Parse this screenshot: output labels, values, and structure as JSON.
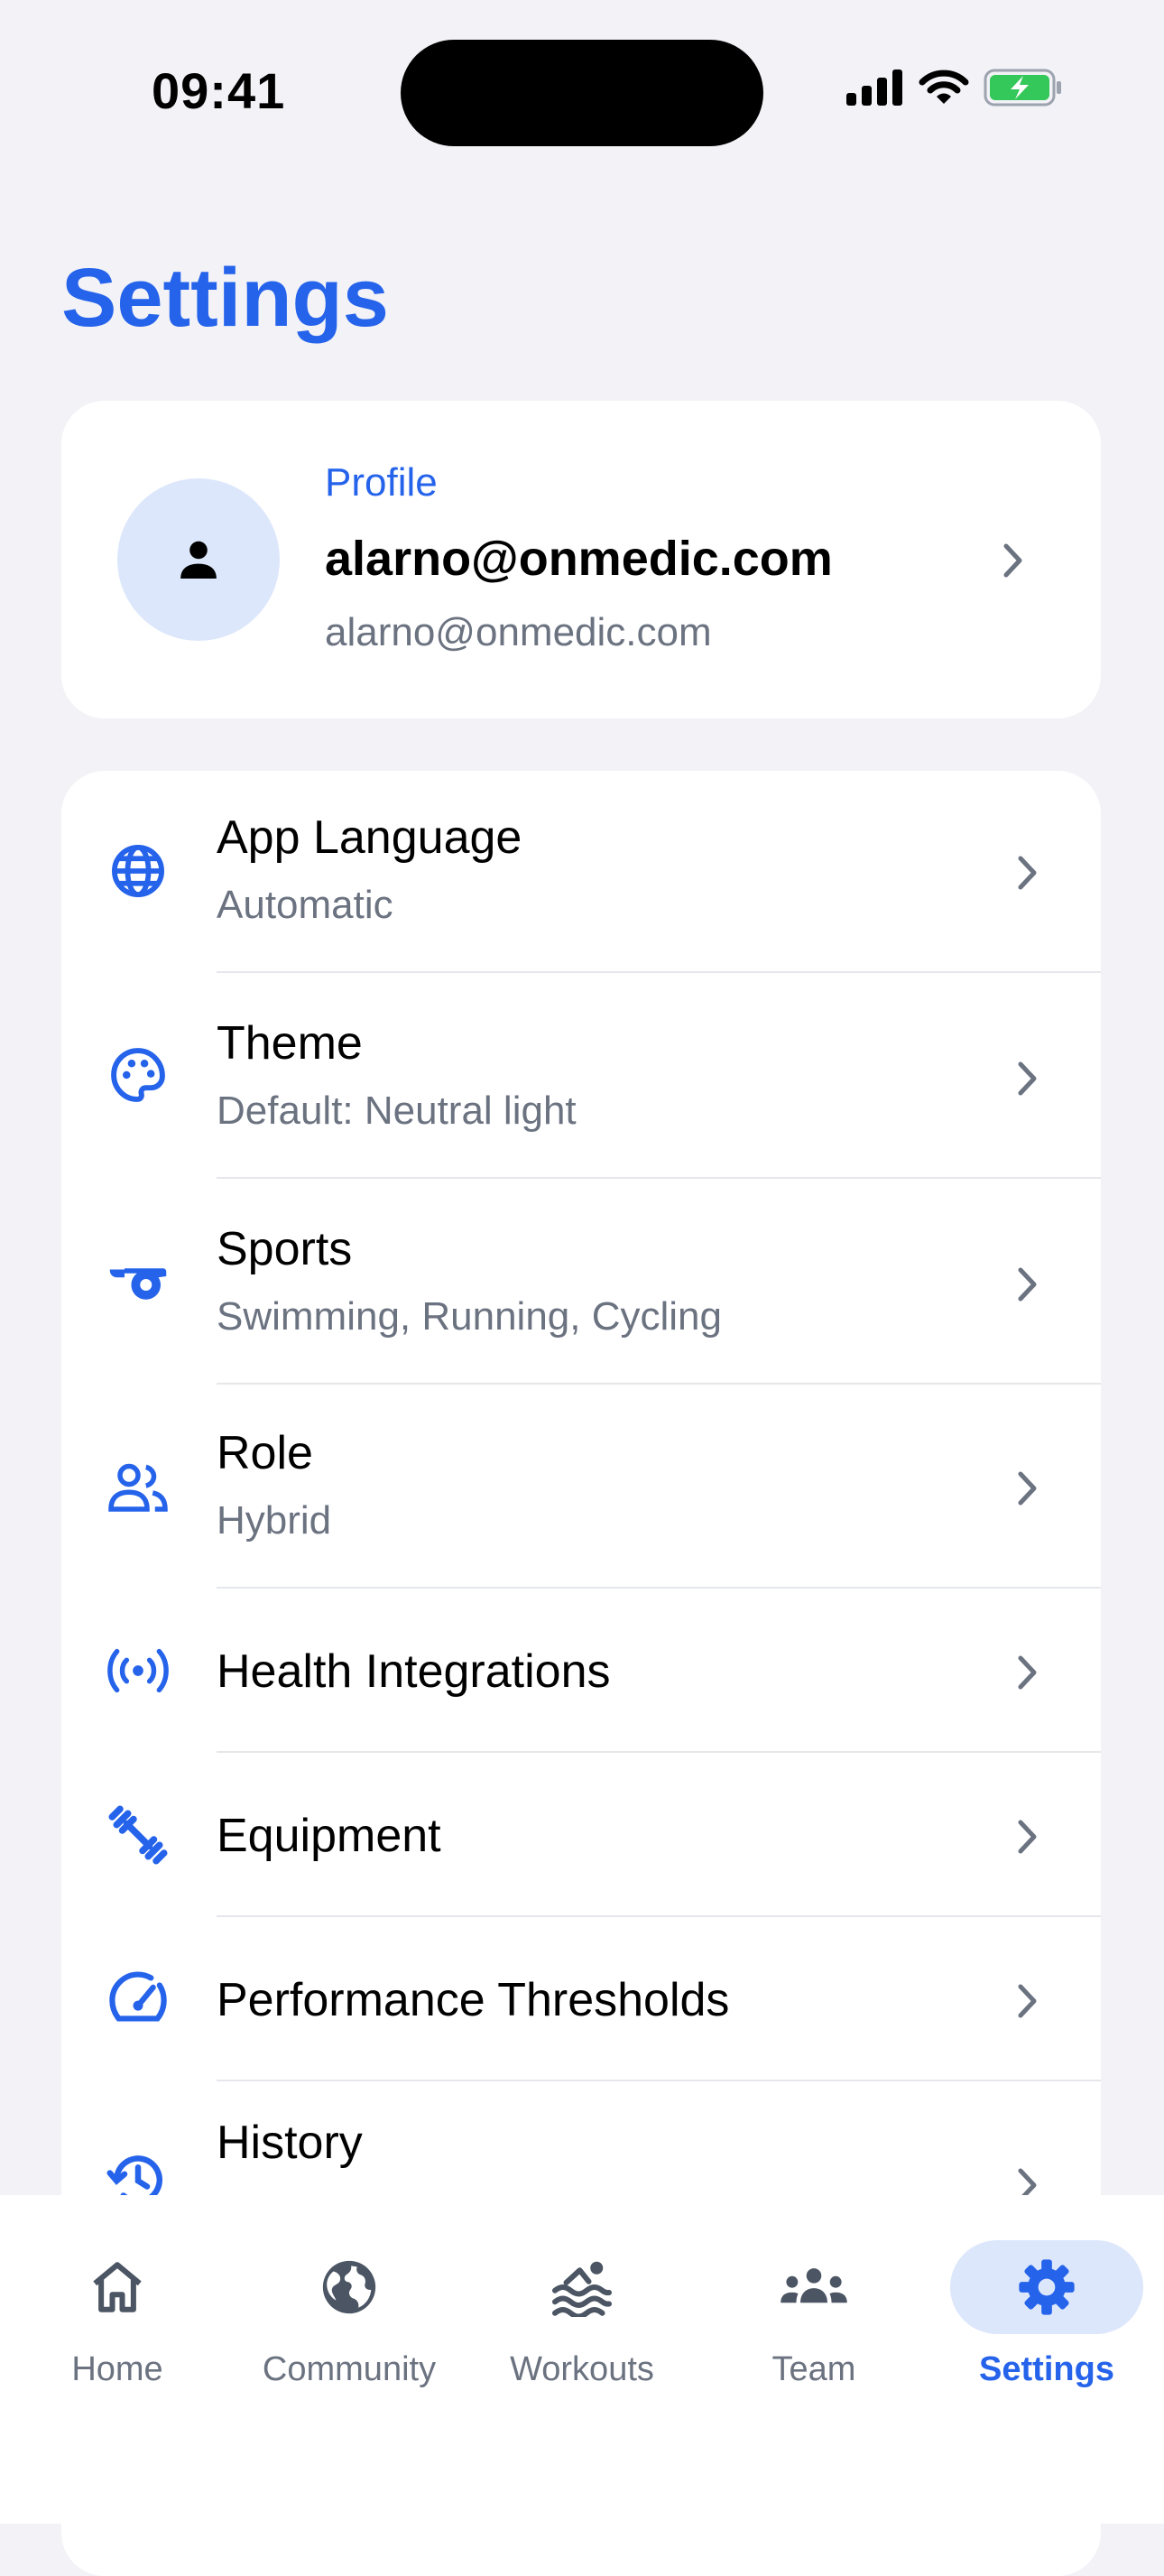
{
  "status": {
    "time": "09:41"
  },
  "header": {
    "title": "Settings"
  },
  "profile": {
    "kicker": "Profile",
    "name": "alarno@onmedic.com",
    "email": "alarno@onmedic.com",
    "avatar_icon": "person-icon"
  },
  "settings": {
    "items": [
      {
        "title": "App Language",
        "subtitle": "Automatic",
        "icon": "globe-icon"
      },
      {
        "title": "Theme",
        "subtitle": "Default: Neutral light",
        "icon": "palette-icon"
      },
      {
        "title": "Sports",
        "subtitle": "Swimming, Running, Cycling",
        "icon": "whistle-icon"
      },
      {
        "title": "Role",
        "subtitle": "Hybrid",
        "icon": "people-icon"
      },
      {
        "title": "Health Integrations",
        "icon": "sensors-icon"
      },
      {
        "title": "Equipment",
        "icon": "fitness-icon"
      },
      {
        "title": "Performance Thresholds",
        "icon": "speedometer-icon"
      },
      {
        "title": "History",
        "icon": "history-icon"
      }
    ]
  },
  "tabbar": {
    "tabs": [
      {
        "label": "Home",
        "icon": "home-icon",
        "active": false
      },
      {
        "label": "Community",
        "icon": "globe-icon",
        "active": false
      },
      {
        "label": "Workouts",
        "icon": "swim-icon",
        "active": false
      },
      {
        "label": "Team",
        "icon": "groups-icon",
        "active": false
      },
      {
        "label": "Settings",
        "icon": "gear-icon",
        "active": true
      }
    ]
  },
  "colors": {
    "accent": "#2563EB",
    "accent_light": "#DCE7FB",
    "background": "#F2F2F7",
    "secondary_text": "#6B7280",
    "battery": "#34C759"
  }
}
